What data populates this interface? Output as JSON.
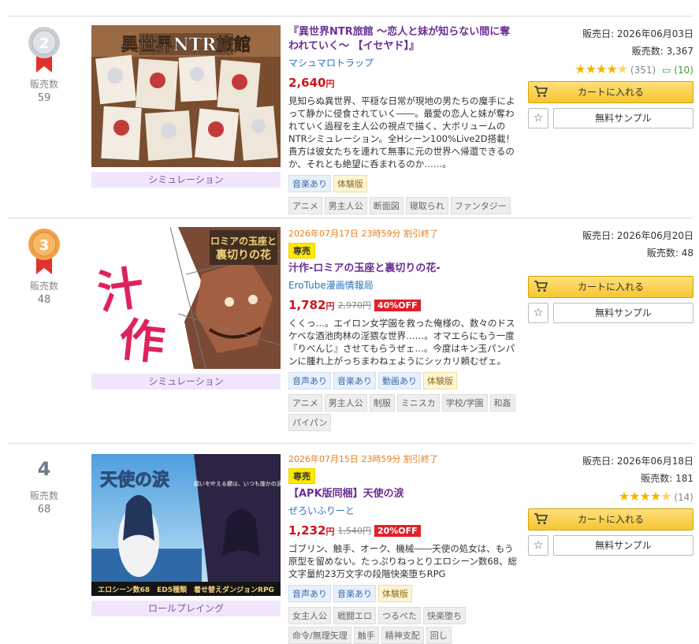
{
  "items": [
    {
      "rank": "2",
      "rank_label": "販売数",
      "rank_count": "59",
      "genre": "シミュレーション",
      "deadline": "",
      "exclusive": "",
      "title": "『異世界NTR旅館 ～恋人と妹が知らない間に奪われていく～ 【イセヤド】』",
      "maker": "マシュマロトラップ",
      "price": "2,640",
      "price_unit": "円",
      "old_price": "",
      "discount": "",
      "description": "見知らぬ異世界、平穏な日常が現地の男たちの魔手によって静かに侵食されていく――。最愛の恋人と妹が奪われていく過程を主人公の視点で描く、大ボリュームのNTRシミュレーション。全Hシーン100%Live2D搭載！貴方は彼女たちを連れて無事に元の世界へ帰還できるのか、それとも絶望に呑まれるのか……。",
      "tags_primary": [
        "音楽あり",
        "体験版"
      ],
      "tags_secondary": [
        "アニメ",
        "男主人公",
        "断面図",
        "寝取られ",
        "ファンタジー"
      ],
      "release": "販売日: 2026年06月03日",
      "sales": "販売数: 3,367",
      "rating_count": "(351)",
      "review_count": "(10)",
      "cart_label": "カートに入れる",
      "sample_label": "無料サンプル",
      "fav_icon": "☆"
    },
    {
      "rank": "3",
      "rank_label": "販売数",
      "rank_count": "48",
      "genre": "シミュレーション",
      "deadline": "2026年07月17日 23時59分 割引終了",
      "exclusive": "専売",
      "title": "汁作-ロミアの玉座と裏切りの花-",
      "maker": "EroTube漫画情報局",
      "price": "1,782",
      "price_unit": "円",
      "old_price": "2,970円",
      "discount": "40%OFF",
      "description": "くくっ…。エイロン女学園を救った俺様の、数々のドスケベな酒池肉林の淫猥な世界……。オマエらにもう一度『りべんじ』させてもらうぜェ…。今度はキン玉パンパンに腫れ上がっちまわねェようにシッカリ頼むぜェ。",
      "tags_primary": [
        "音声あり",
        "音楽あり",
        "動画あり",
        "体験版"
      ],
      "tags_secondary": [
        "アニメ",
        "男主人公",
        "制服",
        "ミニスカ",
        "学校/学園",
        "和姦",
        "パイパン"
      ],
      "release": "販売日: 2026年06月20日",
      "sales": "販売数: 48",
      "rating_count": "",
      "review_count": "",
      "cart_label": "カートに入れる",
      "sample_label": "無料サンプル",
      "fav_icon": "☆"
    },
    {
      "rank": "4",
      "rank_label": "販売数",
      "rank_count": "68",
      "genre": "ロールプレイング",
      "deadline": "2026年07月15日 23時59分 割引終了",
      "exclusive": "専売",
      "title": "【APK版同梱】天使の涙",
      "maker": "ぜろいふりーと",
      "price": "1,232",
      "price_unit": "円",
      "old_price": "1,540円",
      "discount": "20%OFF",
      "description": "ゴブリン、触手、オーク、機械――天使の処女は、もう原型を留めない。たっぷりねっとりエロシーン数68、総文字量約23万文字の段階快楽堕ちRPG",
      "tags_primary": [
        "音声あり",
        "音楽あり",
        "体験版"
      ],
      "tags_secondary": [
        "女主人公",
        "戦闘エロ",
        "つるぺた",
        "快楽堕ち",
        "命令/無理矢理",
        "触手",
        "精神支配",
        "回し"
      ],
      "release": "販売日: 2026年06月18日",
      "sales": "販売数: 181",
      "rating_count": "(14)",
      "review_count": "",
      "cart_label": "カートに入れる",
      "sample_label": "無料サンプル",
      "fav_icon": "☆"
    }
  ],
  "thumb_text": {
    "item1": "異世界NTR旅館",
    "item2_a": "ロミアの玉座と",
    "item2_b": "裏切りの花",
    "item2_big": "汁作",
    "item3_title": "天使の涙",
    "item3_caption": "エロシーン数68　ED5種類　着せ替えダンジョンRPG",
    "item3_sub": "願いを叶える鍵は、いつも誰かの涙だった。"
  },
  "colors": {
    "title": "#6b2f96",
    "price": "#d0121b",
    "deadline": "#e87e1e",
    "link": "#2b72c4",
    "genre_bg": "#f1e6fb",
    "cart_bg": "#f6c633",
    "star": "#f2b600"
  },
  "rating_stars": {
    "item1": 4.5,
    "item3": 4.5
  },
  "rank_icons": {
    "item1": "silver-medal-icon",
    "item2": "bronze-medal-icon"
  }
}
